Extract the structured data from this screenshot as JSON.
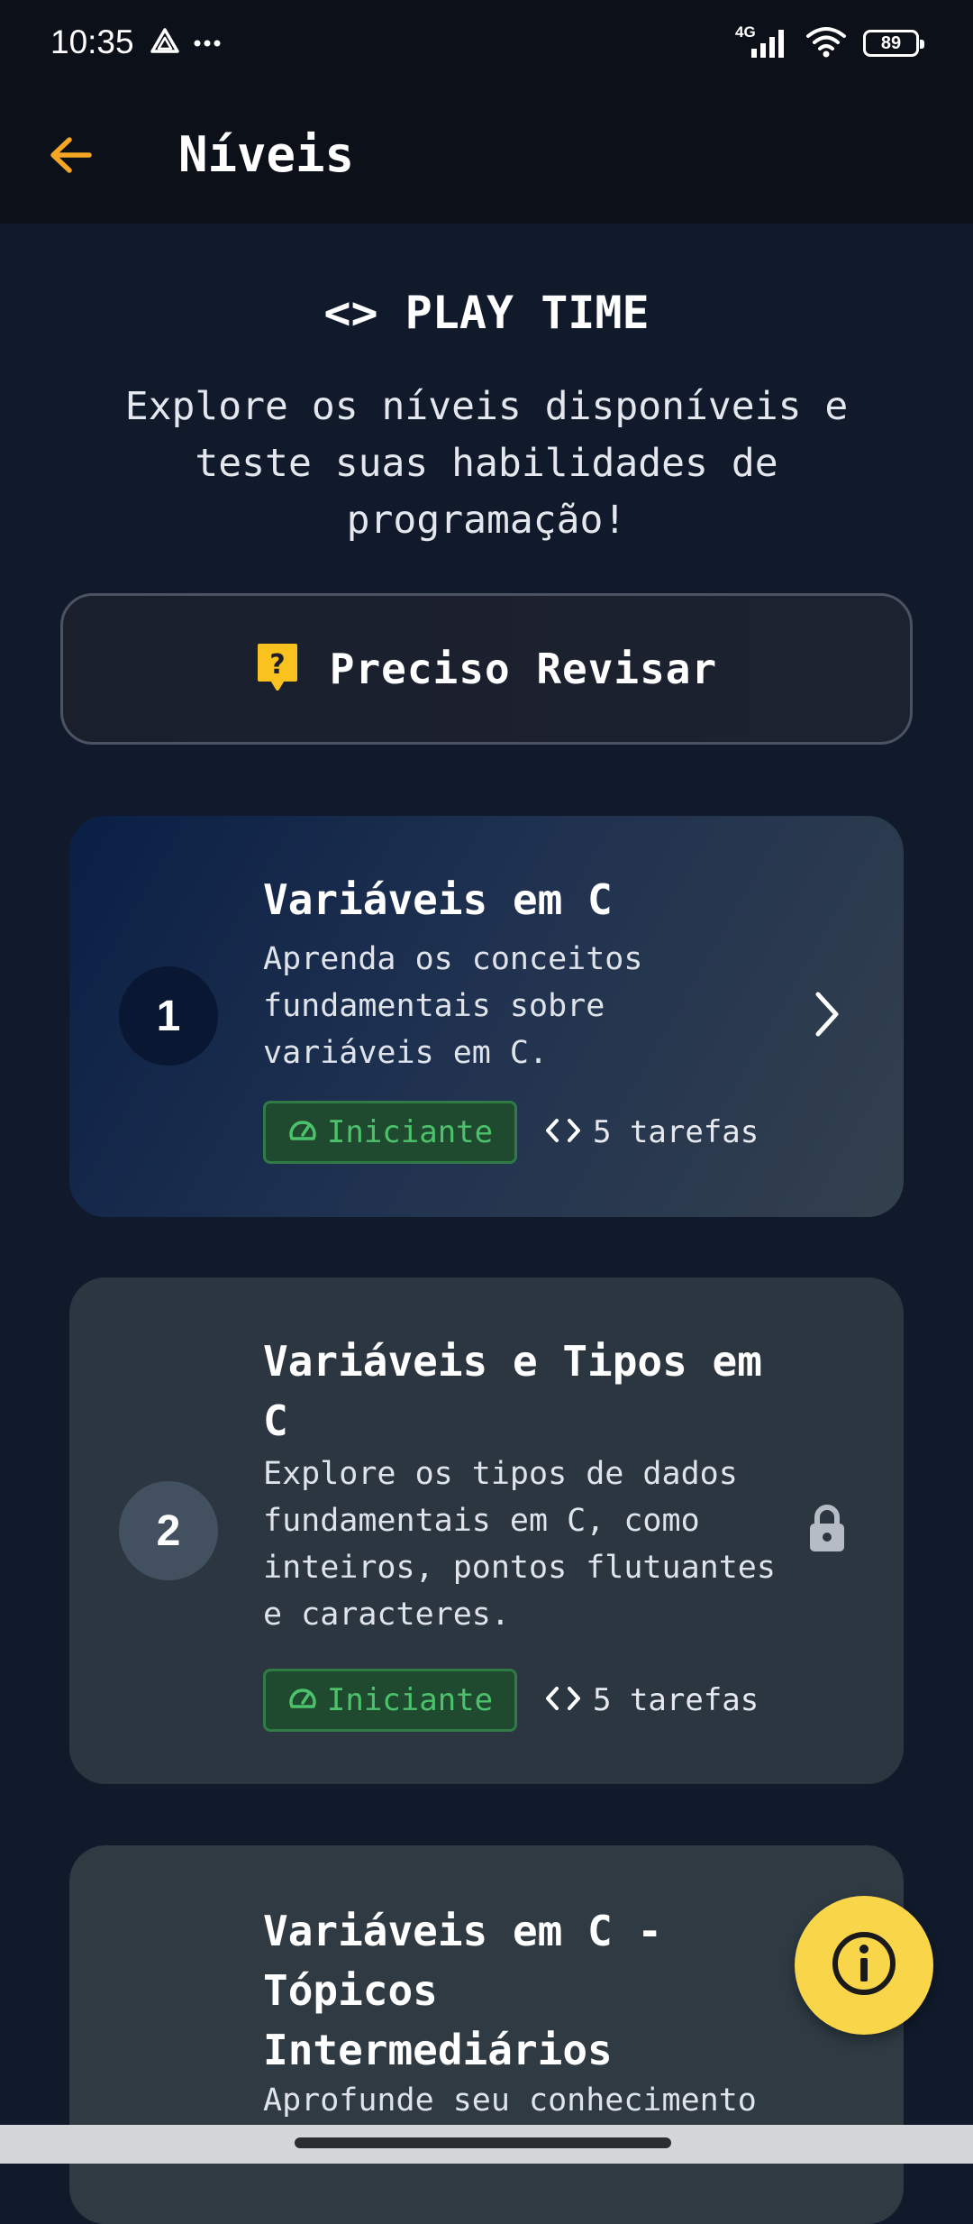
{
  "status_bar": {
    "time": "10:35",
    "left_icons": [
      "drive-icon",
      "more-dots-icon"
    ],
    "network": "4G",
    "battery": "89"
  },
  "app_bar": {
    "back_icon": "arrow-left-icon",
    "title": "Níveis"
  },
  "hero": {
    "title": "<> PLAY TIME",
    "subtitle": "Explore os níveis disponíveis e teste suas habilidades de programação!"
  },
  "review_button": {
    "icon": "question-badge-icon",
    "label": "Preciso Revisar"
  },
  "levels": [
    {
      "number": "1",
      "title": "Variáveis em C",
      "description": "Aprenda os conceitos fundamentais sobre variáveis em C.",
      "difficulty": "Iniciante",
      "tasks": "5 tarefas",
      "action_icon": "chevron-right-icon",
      "locked": false
    },
    {
      "number": "2",
      "title": "Variáveis e Tipos em C",
      "description": "Explore os tipos de dados fundamentais em C, como inteiros, pontos flutuantes e caracteres.",
      "difficulty": "Iniciante",
      "tasks": "5 tarefas",
      "action_icon": "lock-icon",
      "locked": true
    },
    {
      "number": "",
      "title": "Variáveis em C - Tópicos Intermediários",
      "description": "Aprofunde seu conhecimento",
      "difficulty": "",
      "tasks": "",
      "action_icon": "",
      "locked": true
    }
  ],
  "fab": {
    "icon": "info-icon"
  },
  "colors": {
    "accent_orange": "#f5a623",
    "fab_yellow": "#f9d649",
    "success_green": "#4cc26a",
    "background": "#111a2b"
  }
}
